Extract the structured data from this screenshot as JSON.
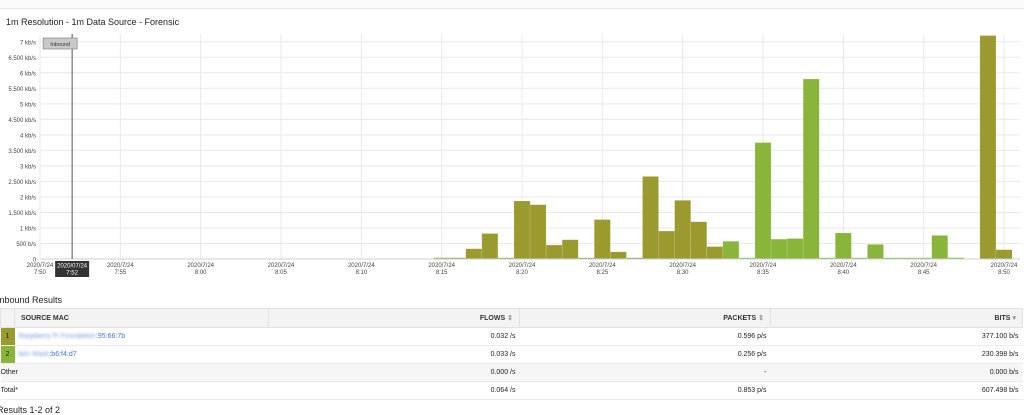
{
  "chart_title": "1m Resolution - 1m Data Source - Forensic",
  "chart_data": {
    "type": "bar",
    "y_axis": {
      "min": 0,
      "max": 7250,
      "ticks": [
        0,
        500,
        1000,
        1500,
        2000,
        2500,
        3000,
        3500,
        4000,
        4500,
        5000,
        5500,
        6000,
        6500,
        7000
      ],
      "tick_labels": [
        "0",
        "500 b/s",
        "1 kb/s",
        "1.500 kb/s",
        "2 kb/s",
        "2.500 kb/s",
        "3 kb/s",
        "3.500 kb/s",
        "4 kb/s",
        "4.500 kb/s",
        "5 kb/s",
        "5.500 kb/s",
        "6 kb/s",
        "6.500 kb/s",
        "7 kb/s"
      ]
    },
    "x_axis": {
      "min": 0,
      "max": 60,
      "ticks": [
        {
          "pos": 0,
          "date": "2020/7/24",
          "time": "7:50"
        },
        {
          "pos": 5,
          "date": "2020/7/24",
          "time": "7:55"
        },
        {
          "pos": 10,
          "date": "2020/7/24",
          "time": "8:00"
        },
        {
          "pos": 15,
          "date": "2020/7/24",
          "time": "8:05"
        },
        {
          "pos": 20,
          "date": "2020/7/24",
          "time": "8:10"
        },
        {
          "pos": 25,
          "date": "2020/7/24",
          "time": "8:15"
        },
        {
          "pos": 30,
          "date": "2020/7/24",
          "time": "8:20"
        },
        {
          "pos": 35,
          "date": "2020/7/24",
          "time": "8:25"
        },
        {
          "pos": 40,
          "date": "2020/7/24",
          "time": "8:30"
        },
        {
          "pos": 45,
          "date": "2020/7/24",
          "time": "8:35"
        },
        {
          "pos": 50,
          "date": "2020/7/24",
          "time": "8:40"
        },
        {
          "pos": 55,
          "date": "2020/7/24",
          "time": "8:45"
        },
        {
          "pos": 60,
          "date": "2020/7/24",
          "time": "8:50"
        }
      ]
    },
    "grid": true,
    "cursor": {
      "pos": 2,
      "date": "2020/07/24",
      "time": "7:52",
      "tooltip": "Inbound"
    },
    "series": [
      {
        "color": "#9a9a2f",
        "bars": [
          {
            "t": 25,
            "v": 40
          },
          {
            "t": 26,
            "v": 40
          },
          {
            "t": 27,
            "v": 330
          },
          {
            "t": 28,
            "v": 820
          },
          {
            "t": 29,
            "v": 40
          },
          {
            "t": 30,
            "v": 1870
          },
          {
            "t": 31,
            "v": 1750
          },
          {
            "t": 32,
            "v": 450
          },
          {
            "t": 33,
            "v": 620
          },
          {
            "t": 34,
            "v": 40
          },
          {
            "t": 35,
            "v": 1270
          },
          {
            "t": 36,
            "v": 230
          },
          {
            "t": 37,
            "v": 40
          },
          {
            "t": 38,
            "v": 2660
          },
          {
            "t": 39,
            "v": 900
          },
          {
            "t": 40,
            "v": 1890
          },
          {
            "t": 41,
            "v": 1200
          },
          {
            "t": 42,
            "v": 400
          },
          {
            "t": 47,
            "v": 40
          },
          {
            "t": 48,
            "v": 40
          },
          {
            "t": 52,
            "v": 40
          },
          {
            "t": 56,
            "v": 40
          },
          {
            "t": 57,
            "v": 40
          },
          {
            "t": 59,
            "v": 7200
          },
          {
            "t": 60,
            "v": 300
          }
        ]
      },
      {
        "color": "#88b53a",
        "bars": [
          {
            "t": 43,
            "v": 570
          },
          {
            "t": 44,
            "v": 40
          },
          {
            "t": 45,
            "v": 3750
          },
          {
            "t": 46,
            "v": 640
          },
          {
            "t": 47,
            "v": 660
          },
          {
            "t": 48,
            "v": 5800
          },
          {
            "t": 49,
            "v": 40
          },
          {
            "t": 50,
            "v": 840
          },
          {
            "t": 51,
            "v": 40
          },
          {
            "t": 52,
            "v": 470
          },
          {
            "t": 53,
            "v": 40
          },
          {
            "t": 54,
            "v": 40
          },
          {
            "t": 55,
            "v": 40
          },
          {
            "t": 56,
            "v": 760
          },
          {
            "t": 57,
            "v": 40
          }
        ]
      }
    ]
  },
  "results": {
    "title": "Inbound Results",
    "columns": {
      "source_mac": "SOURCE MAC",
      "flows": "FLOWS",
      "packets": "PACKETS",
      "bits": "BITS"
    },
    "sort_icon": "sort-icon",
    "rows": [
      {
        "index": "1",
        "color": "#9a9a2f",
        "mac_hidden": "Raspberry Pi Foundation",
        "mac_suffix": ":95:66:7b",
        "flows": "0.032 /s",
        "packets": "0.596 p/s",
        "bits": "377.100 b/s"
      },
      {
        "index": "2",
        "color": "#88b53a",
        "mac_hidden": "Ikm Wash",
        "mac_suffix": ":b6:f4:d7",
        "flows": "0.033 /s",
        "packets": "0.256 p/s",
        "bits": "230.398 b/s"
      }
    ],
    "other": {
      "label": "Other",
      "flows": "0.000 /s",
      "packets": "-",
      "bits": "0.000 b/s"
    },
    "total": {
      "label": "Total*",
      "flows": "0.064 /s",
      "packets": "0.853 p/s",
      "bits": "607.498 b/s"
    },
    "count_text": "Results 1-2 of 2"
  }
}
